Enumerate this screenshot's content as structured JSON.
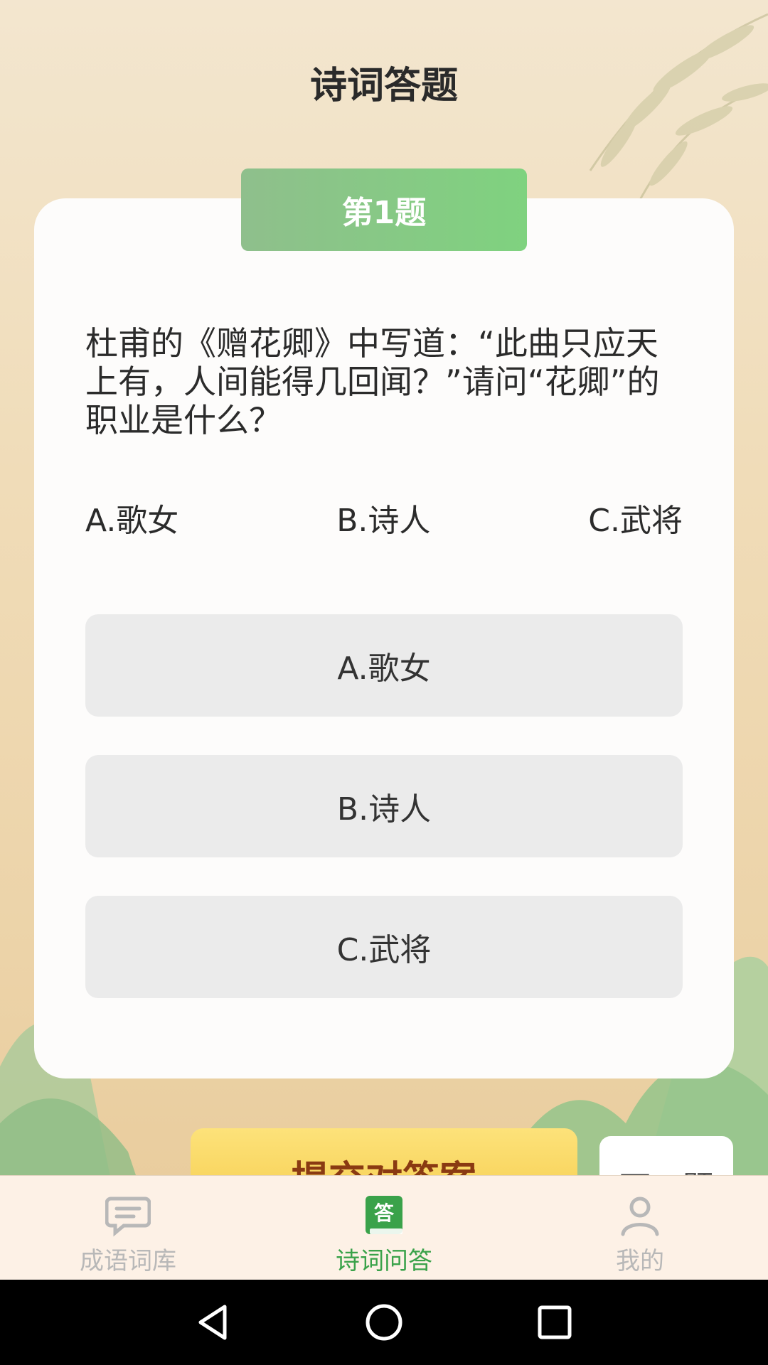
{
  "header": {
    "title": "诗词答题"
  },
  "quiz": {
    "badge": "第1题",
    "question": "杜甫的《赠花卿》中写道：“此曲只应天上有，人间能得几回闻？”请问“花卿”的职业是什么？",
    "options_inline": [
      "A.歌女",
      "B.诗人",
      "C.武将"
    ],
    "answers": [
      "A.歌女",
      "B.诗人",
      "C.武将"
    ],
    "submit_label": "提交对答案",
    "next_label": "下一题"
  },
  "tabs": [
    {
      "label": "成语词库",
      "icon": "chat-icon",
      "active": false
    },
    {
      "label": "诗词问答",
      "icon": "answer-book-icon",
      "active": true
    },
    {
      "label": "我的",
      "icon": "person-icon",
      "active": false
    }
  ],
  "colors": {
    "accent_green": "#3aa24a",
    "badge_green": "#7fd27f",
    "submit_yellow": "#f6cf52"
  }
}
